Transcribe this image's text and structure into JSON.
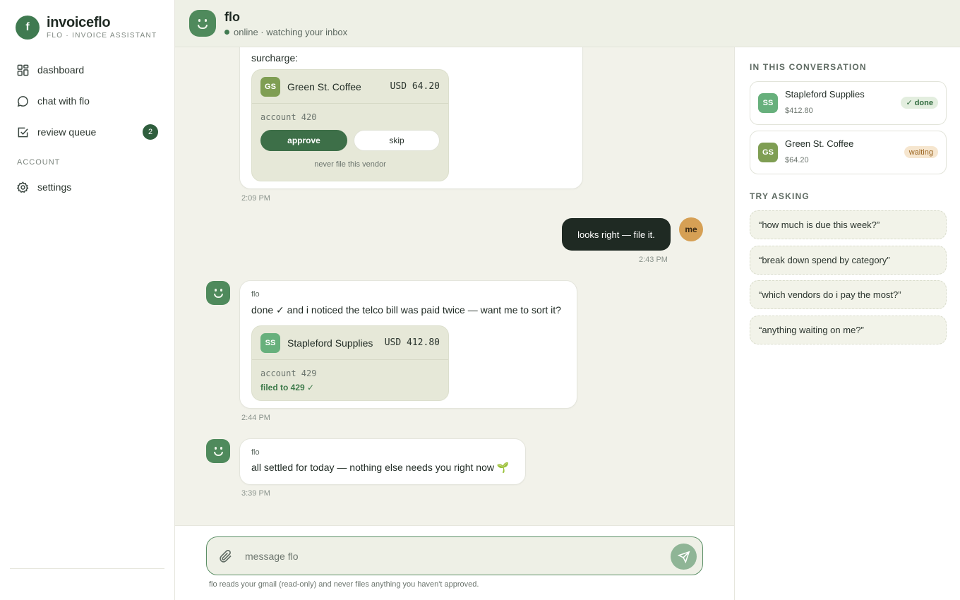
{
  "brand": {
    "logo_letter": "f",
    "name": "invoiceflo",
    "subtitle": "FLO · INVOICE ASSISTANT"
  },
  "sidebar": {
    "items": [
      {
        "label": "dashboard",
        "icon": "grid-icon"
      },
      {
        "label": "chat with flo",
        "icon": "chat-bubble-icon"
      },
      {
        "label": "review queue",
        "icon": "checkbox-icon",
        "badge": "2"
      }
    ],
    "section_account": "ACCOUNT",
    "settings_label": "settings"
  },
  "header": {
    "title": "flo",
    "status": "online · watching your inbox"
  },
  "chat": {
    "msg1": {
      "text_tail": "surcharge:",
      "card": {
        "initials": "GS",
        "vendor": "Green St. Coffee",
        "amount": "USD 64.20",
        "account": "account 420",
        "approve_label": "approve",
        "skip_label": "skip",
        "never_label": "never file this vendor"
      },
      "time": "2:09 PM"
    },
    "user_msg": {
      "avatar": "me",
      "text": "looks right — file it.",
      "time": "2:43 PM"
    },
    "msg2": {
      "sender": "flo",
      "text": "done ✓ and i noticed the telco bill was paid twice — want me to sort it?",
      "card": {
        "initials": "SS",
        "vendor": "Stapleford Supplies",
        "amount": "USD 412.80",
        "account": "account 429",
        "filed": "filed to 429 ✓"
      },
      "time": "2:44 PM"
    },
    "msg3": {
      "sender": "flo",
      "text": "all settled for today — nothing else needs you right now 🌱",
      "time": "3:39 PM"
    }
  },
  "composer": {
    "placeholder": "message flo",
    "value": "",
    "note": "flo reads your gmail (read-only) and never files anything you haven't approved."
  },
  "right_panel": {
    "conversation_title": "IN THIS CONVERSATION",
    "conversation": [
      {
        "initials": "SS",
        "vendor": "Stapleford Supplies",
        "amount": "$412.80",
        "status": "✓ done"
      },
      {
        "initials": "GS",
        "vendor": "Green St. Coffee",
        "amount": "$64.20",
        "status": "waiting"
      }
    ],
    "try_title": "TRY ASKING",
    "suggestions": [
      "“how much is due this week?”",
      "“break down spend by category”",
      "“which vendors do i pay the most?”",
      "“anything waiting on me?”"
    ]
  },
  "colors": {
    "accent": "#3f7a50",
    "dark_bubble": "#1f2a23",
    "badge_gs": "#7f9e53",
    "badge_ss": "#67b07c",
    "me_avatar": "#d6a055"
  }
}
